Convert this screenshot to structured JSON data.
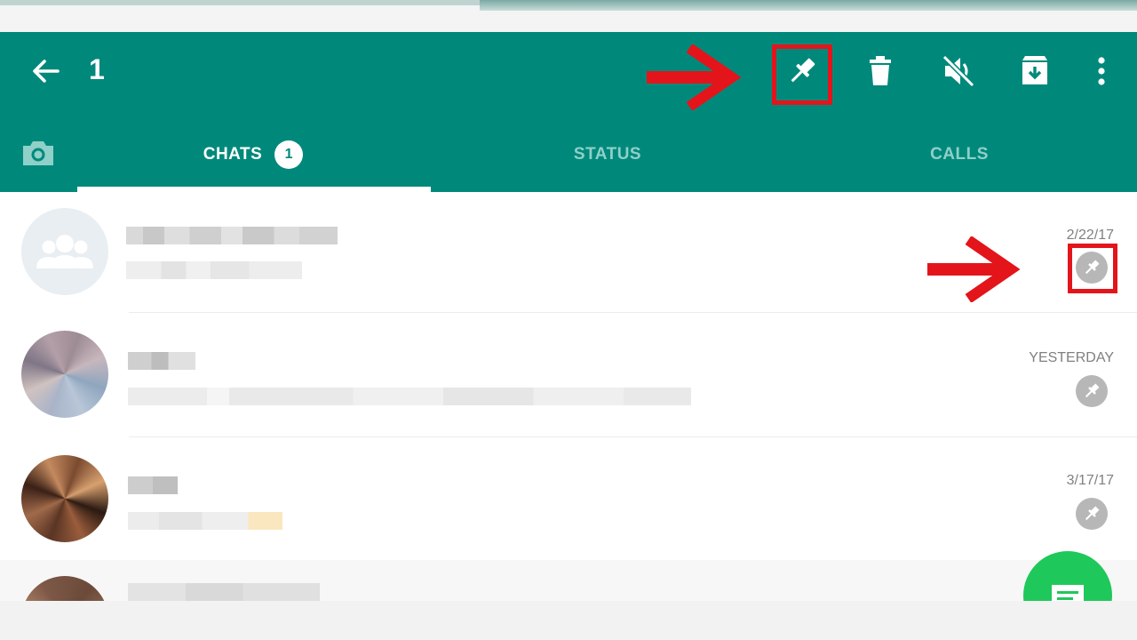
{
  "header": {
    "selected_count": "1",
    "actions": [
      {
        "name": "pin-icon",
        "label": "Pin chat"
      },
      {
        "name": "delete-icon",
        "label": "Delete"
      },
      {
        "name": "mute-icon",
        "label": "Mute"
      },
      {
        "name": "archive-icon",
        "label": "Archive"
      },
      {
        "name": "more-options-icon",
        "label": "More options"
      }
    ]
  },
  "tabs": {
    "camera_icon": "camera-icon",
    "items": [
      {
        "label": "CHATS",
        "badge": "1",
        "active": true
      },
      {
        "label": "STATUS",
        "active": false
      },
      {
        "label": "CALLS",
        "active": false
      }
    ]
  },
  "chats": [
    {
      "date": "2/22/17",
      "pinned": true,
      "avatar": "group-avatar-icon"
    },
    {
      "date": "YESTERDAY",
      "pinned": true,
      "avatar": "photo"
    },
    {
      "date": "3/17/17",
      "pinned": true,
      "avatar": "photo"
    }
  ],
  "colors": {
    "appbar": "#00897b",
    "annotation_red": "#e4141b",
    "fab": "#1fc85a",
    "pin_badge": "#b7b7b7"
  },
  "fab_icon": "new-chat-icon"
}
